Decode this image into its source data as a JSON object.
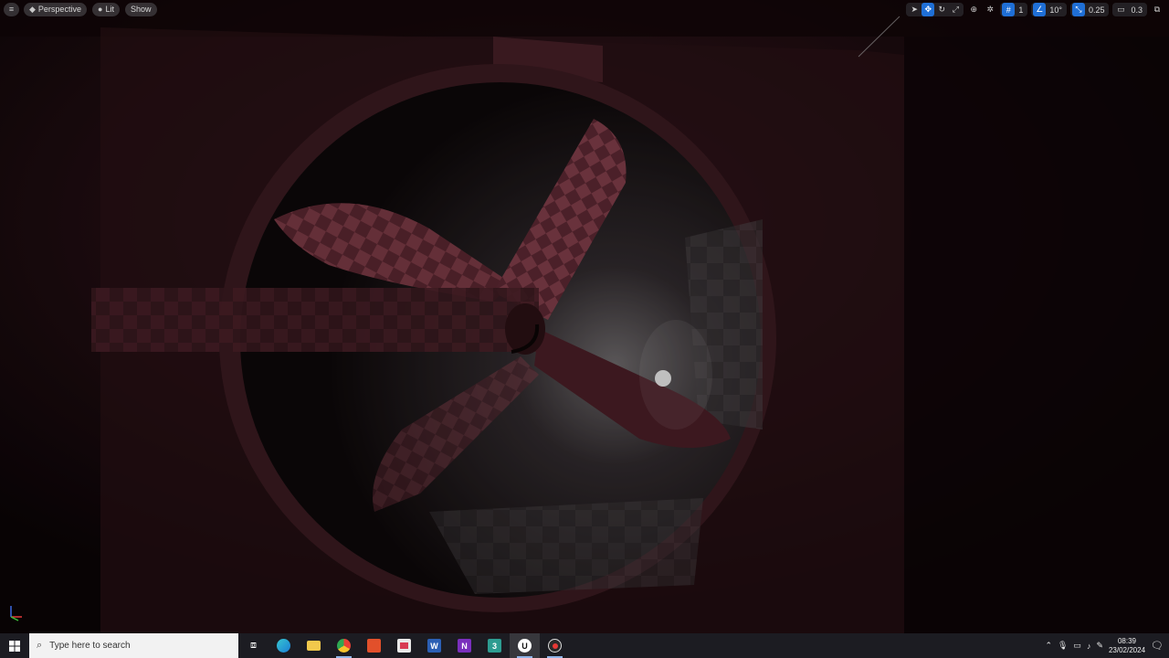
{
  "viewport_toolbar": {
    "menu_icon": "hamburger-icon",
    "view_mode": "Perspective",
    "lighting_mode": "Lit",
    "show_label": "Show",
    "transform_tools": [
      "select-icon",
      "move-icon",
      "rotate-icon",
      "scale-icon"
    ],
    "grid_snap_value": "1",
    "rotation_snap_value": "10°",
    "scale_snap_value": "0.25",
    "camera_speed_value": "0.3",
    "accent": "#1f6fd6"
  },
  "taskbar": {
    "search_placeholder": "Type here to search",
    "apps": [
      {
        "name": "task-view",
        "icon": "task-view-icon"
      },
      {
        "name": "edge",
        "icon": "edge-icon"
      },
      {
        "name": "file-explorer",
        "icon": "folder-icon"
      },
      {
        "name": "chrome",
        "icon": "chrome-icon"
      },
      {
        "name": "office",
        "icon": "office-icon"
      },
      {
        "name": "store",
        "icon": "store-icon"
      },
      {
        "name": "word",
        "icon": "word-icon",
        "letter": "W"
      },
      {
        "name": "onenote",
        "icon": "onenote-icon",
        "letter": "N"
      },
      {
        "name": "app-3",
        "icon": "app-icon",
        "letter": "3"
      },
      {
        "name": "unreal-engine",
        "icon": "unreal-icon",
        "letter": "U"
      },
      {
        "name": "recorder",
        "icon": "record-icon"
      }
    ],
    "clock_time": "08:39",
    "clock_date": "23/02/2024"
  }
}
